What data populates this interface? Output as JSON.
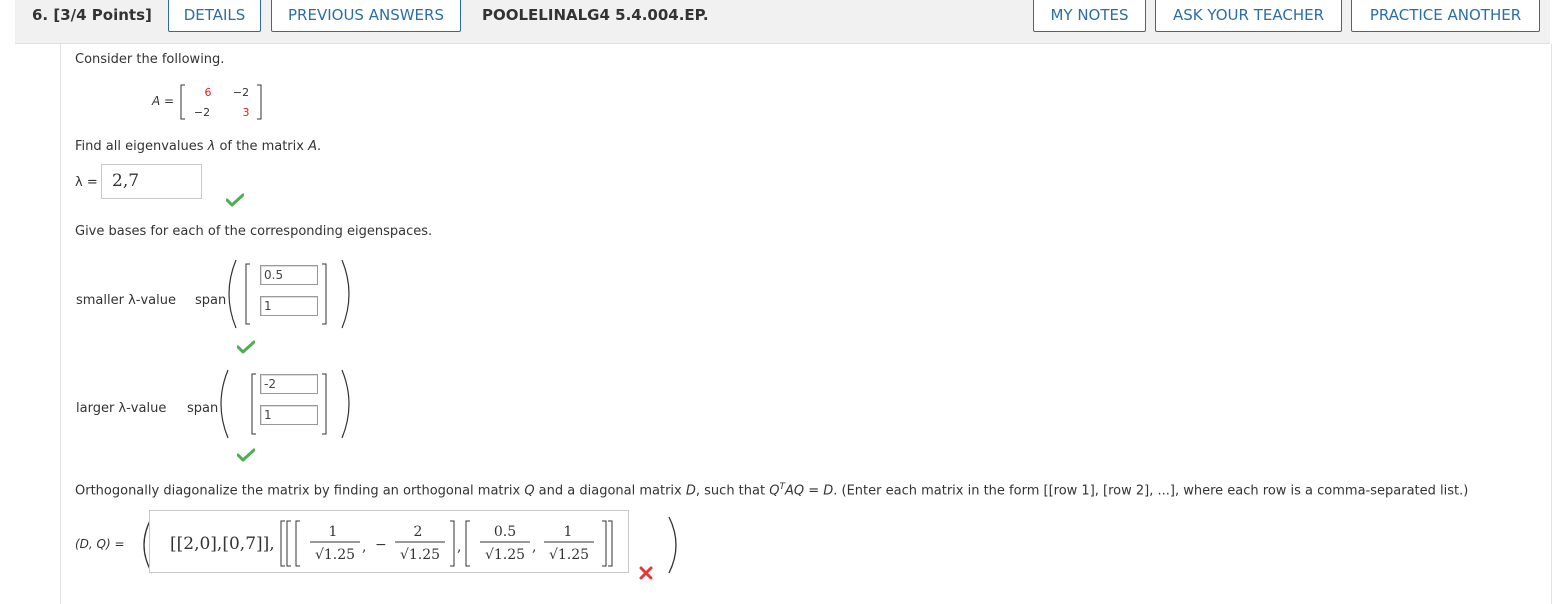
{
  "header": {
    "question_number": "6.",
    "points": "[3/4 Points]",
    "details_label": "DETAILS",
    "previous_answers_label": "PREVIOUS ANSWERS",
    "problem_id": "POOLELINALG4 5.4.004.EP.",
    "my_notes_label": "MY NOTES",
    "ask_teacher_label": "ASK YOUR TEACHER",
    "practice_another_label": "PRACTICE ANOTHER"
  },
  "problem": {
    "intro": "Consider the following.",
    "matrix_label": "A =",
    "matrix": [
      [
        "6",
        "−2"
      ],
      [
        "−2",
        "3"
      ]
    ],
    "eigen_prompt_pre": "Find all eigenvalues ",
    "lambda": "λ",
    "eigen_prompt_post": " of the matrix ",
    "matrix_name": "A",
    "period": ".",
    "lambda_eq": "λ =",
    "eigenvalues_answer": "2,7",
    "bases_prompt": "Give bases for each of the corresponding eigenspaces.",
    "smaller_label": "smaller λ-value",
    "larger_label": "larger λ-value",
    "span_label": "span",
    "smaller_vector": [
      "0.5",
      "1"
    ],
    "larger_vector": [
      "-2",
      "1"
    ],
    "diag_prompt_pre": "Orthogonally diagonalize the matrix by finding an orthogonal matrix ",
    "diag_prompt_q": "Q",
    "diag_prompt_mid": " and a diagonal matrix ",
    "diag_prompt_d": "D",
    "diag_prompt_mid2": ", such that ",
    "diag_prompt_eq": "Q",
    "diag_prompt_t": "T",
    "diag_prompt_aq": "AQ = D",
    "diag_prompt_post": ". (Enter each matrix in the form [[row 1], [row 2], ...], where each row is a comma-separated list.)",
    "dq_label": "(D, Q) =",
    "dq_answer": {
      "d_part": "[[2,0],[0,7]],",
      "q_entries": [
        "1",
        "√1.25",
        "2",
        "√1.25",
        "0.5",
        "√1.25",
        "1",
        "√1.25"
      ]
    }
  },
  "status": {
    "eigenvalues": "correct",
    "smaller_basis": "correct",
    "larger_basis": "correct",
    "diagonalization": "incorrect"
  },
  "colors": {
    "link_blue": "#2b6ea5",
    "check_green": "#4caf50",
    "x_red": "#e53935",
    "matrix_red": "#e02020"
  }
}
